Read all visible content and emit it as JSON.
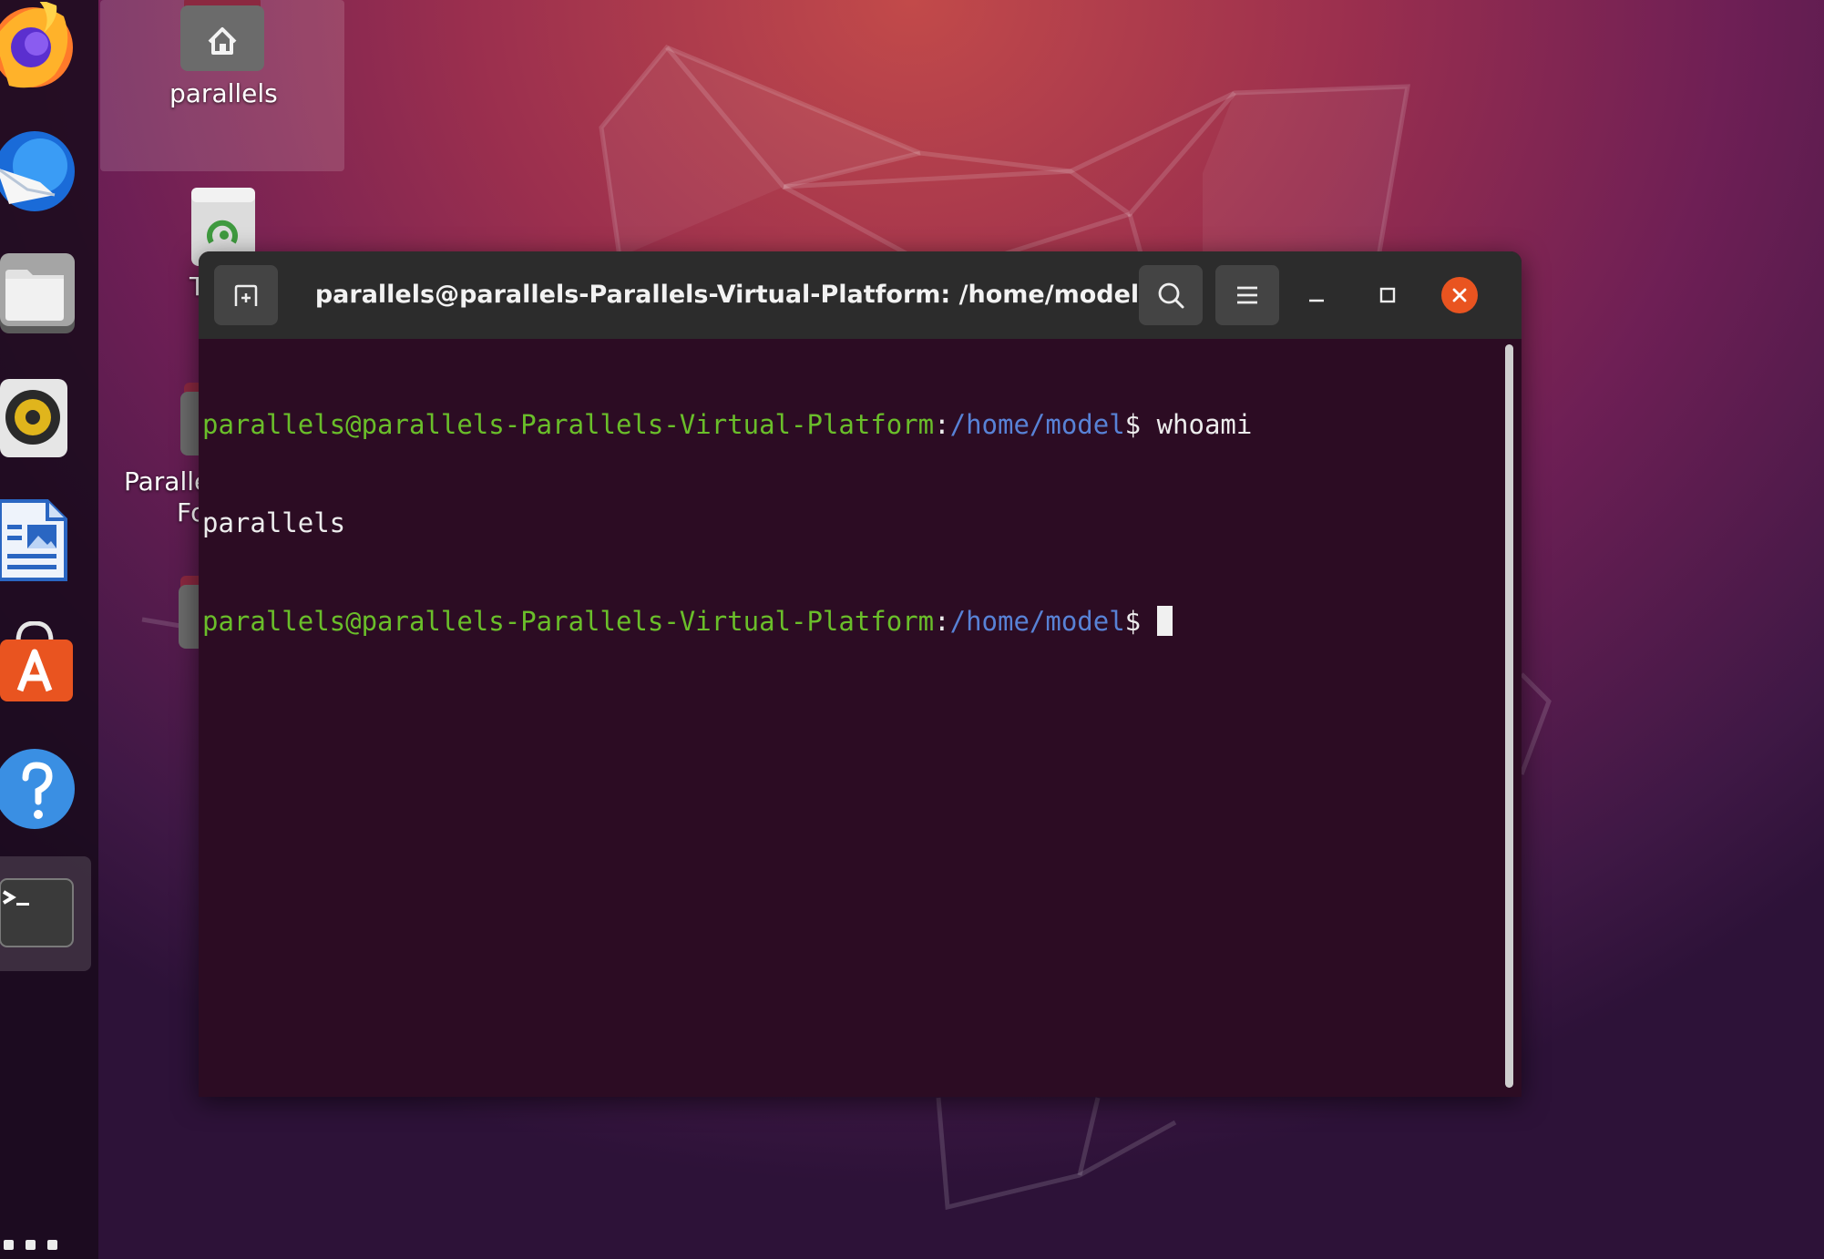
{
  "desktop": {
    "icons": [
      {
        "label": "parallels",
        "icon": "home-folder-icon"
      },
      {
        "label": "T",
        "icon": "trash-icon"
      },
      {
        "label": "Paralle",
        "label2": "Fo",
        "icon": "shared-folder-icon"
      },
      {
        "label": "",
        "icon": "folder-icon"
      }
    ]
  },
  "dock": {
    "apps": [
      {
        "name": "Firefox",
        "icon": "firefox-icon"
      },
      {
        "name": "Thunderbird",
        "icon": "thunderbird-icon"
      },
      {
        "name": "Files",
        "icon": "files-icon"
      },
      {
        "name": "Rhythmbox",
        "icon": "rhythmbox-icon"
      },
      {
        "name": "LibreOffice Writer",
        "icon": "writer-icon"
      },
      {
        "name": "Ubuntu Software",
        "icon": "software-icon"
      },
      {
        "name": "Help",
        "icon": "help-icon"
      },
      {
        "name": "Terminal",
        "icon": "terminal-icon",
        "active": true
      }
    ],
    "show_apps_icon": "app-grid-icon"
  },
  "terminal": {
    "title": "parallels@parallels-Parallels-Virtual-Platform: /home/model",
    "lines": [
      {
        "user": "parallels@parallels-Parallels-Virtual-Platform",
        "sep": ":",
        "path": "/home/model",
        "prompt": "$ ",
        "cmd": "whoami"
      },
      {
        "output": "parallels"
      },
      {
        "user": "parallels@parallels-Parallels-Virtual-Platform",
        "sep": ":",
        "path": "/home/model",
        "prompt": "$ ",
        "cmd": ""
      }
    ],
    "buttons": {
      "new_tab": "new-tab-icon",
      "search": "search-icon",
      "menu": "hamburger-menu-icon",
      "minimize": "minimize-icon",
      "maximize": "maximize-icon",
      "close": "close-icon"
    },
    "colors": {
      "prompt_user": "#6abe2a",
      "prompt_path": "#5882d6",
      "background": "#2c0c23",
      "close": "#e95420"
    }
  }
}
